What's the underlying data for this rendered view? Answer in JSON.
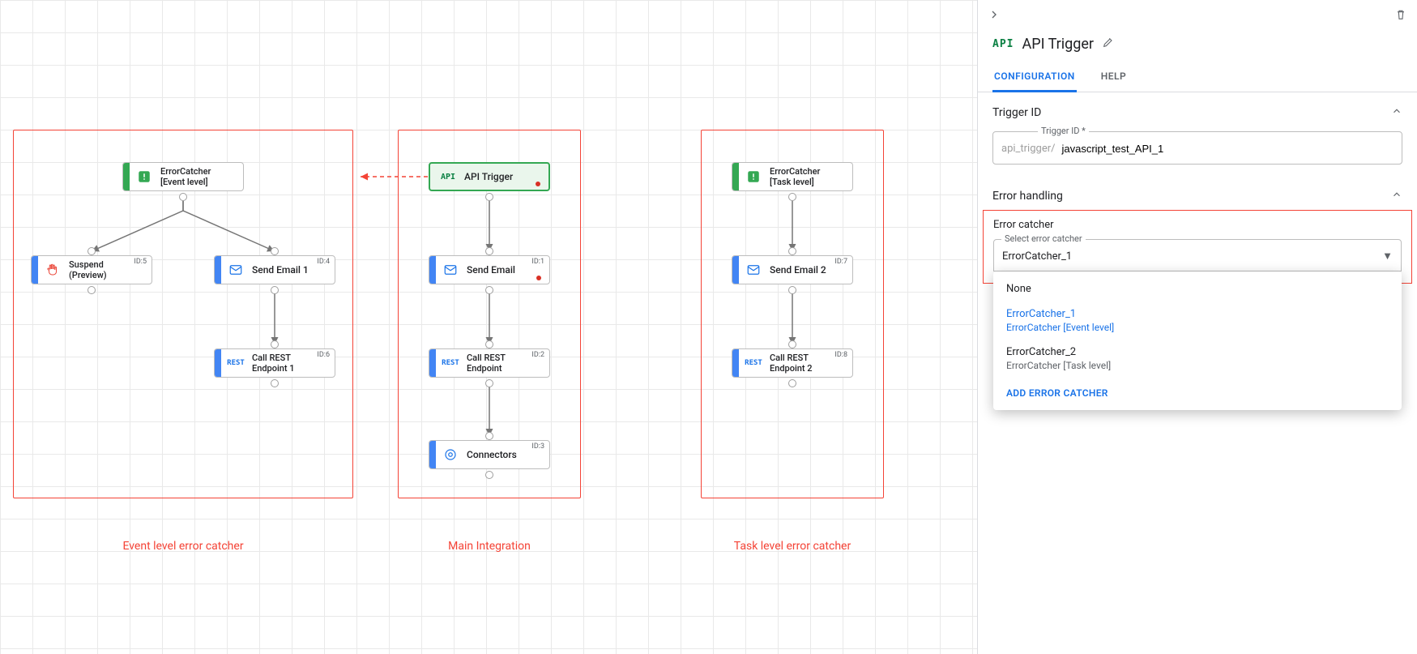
{
  "canvas": {
    "sections": {
      "event": {
        "label": "Event level error catcher"
      },
      "main": {
        "label": "Main Integration"
      },
      "task": {
        "label": "Task level error catcher"
      }
    },
    "nodes": {
      "event_catcher": {
        "line1": "ErrorCatcher",
        "line2": "[Event level]"
      },
      "suspend": {
        "line1": "Suspend",
        "line2": "(Preview)",
        "id": "ID:5"
      },
      "send_email_1": {
        "line1": "Send Email 1",
        "id": "ID:4"
      },
      "rest_1": {
        "line1": "Call REST",
        "line2": "Endpoint 1",
        "id": "ID:6"
      },
      "api_trigger": {
        "line1": "API Trigger"
      },
      "send_email": {
        "line1": "Send Email",
        "id": "ID:1"
      },
      "rest": {
        "line1": "Call REST",
        "line2": "Endpoint",
        "id": "ID:2"
      },
      "connectors": {
        "line1": "Connectors",
        "id": "ID:3"
      },
      "task_catcher": {
        "line1": "ErrorCatcher",
        "line2": "[Task level]"
      },
      "send_email_2": {
        "line1": "Send Email 2",
        "id": "ID:7"
      },
      "rest_2": {
        "line1": "Call REST",
        "line2": "Endpoint 2",
        "id": "ID:8"
      }
    }
  },
  "panel": {
    "title": "API Trigger",
    "badge": "API",
    "tabs": {
      "config": "CONFIGURATION",
      "help": "HELP"
    },
    "trigger_section": "Trigger ID",
    "trigger_legend": "Trigger ID *",
    "trigger_prefix": "api_trigger/",
    "trigger_value": "javascript_test_API_1",
    "error_section": "Error handling",
    "error_box_title": "Error catcher",
    "select_legend": "Select error catcher",
    "select_value": "ErrorCatcher_1",
    "dropdown": {
      "none": "None",
      "opt1": {
        "name": "ErrorCatcher_1",
        "sub": "ErrorCatcher [Event level]"
      },
      "opt2": {
        "name": "ErrorCatcher_2",
        "sub": "ErrorCatcher [Task level]"
      },
      "add": "ADD ERROR CATCHER"
    }
  }
}
